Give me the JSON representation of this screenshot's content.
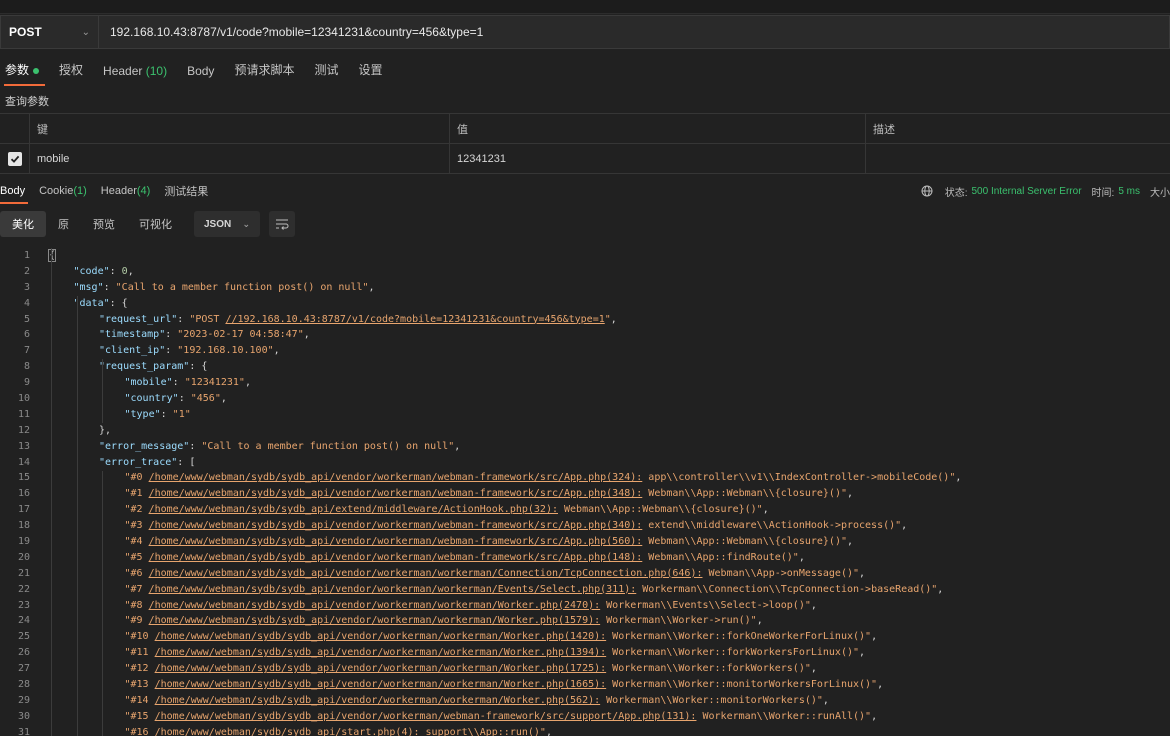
{
  "request": {
    "method": "POST",
    "url": "192.168.10.43:8787/v1/code?mobile=12341231&country=456&type=1"
  },
  "req_tabs": [
    {
      "label": "参数",
      "dot": true,
      "active": true
    },
    {
      "label": "授权"
    },
    {
      "label": "Header",
      "count": "(10)"
    },
    {
      "label": "Body"
    },
    {
      "label": "预请求脚本"
    },
    {
      "label": "测试"
    },
    {
      "label": "设置"
    }
  ],
  "params": {
    "section_title": "查询参数",
    "headers": {
      "key": "键",
      "value": "值",
      "desc": "描述"
    },
    "rows": [
      {
        "key": "mobile",
        "value": "12341231",
        "desc": ""
      }
    ]
  },
  "res_tabs": [
    {
      "label": "Body",
      "active": true
    },
    {
      "label": "Cookie",
      "count": "(1)"
    },
    {
      "label": "Header",
      "count": "(4)"
    },
    {
      "label": "测试结果"
    }
  ],
  "status": {
    "status_label": "状态:",
    "status_value": "500 Internal Server Error",
    "time_label": "时间:",
    "time_value": "5 ms",
    "size_label": "大小"
  },
  "view_tabs": [
    "美化",
    "原",
    "预览",
    "可视化"
  ],
  "format": "JSON",
  "icons": {
    "method_chevron": "chevron-down-icon",
    "checkbox": "check-icon",
    "network": "globe-icon",
    "wrap": "wrap-lines-icon"
  },
  "colors": {
    "accent": "#f26b3a",
    "success": "#3bc16e",
    "key": "#9cdcfe",
    "string": "#e8a56e"
  },
  "code_lines": [
    {
      "n": "1",
      "i": 0,
      "t": [
        [
          "p",
          "{"
        ]
      ]
    },
    {
      "n": "2",
      "i": 1,
      "t": [
        [
          "k",
          "\"code\""
        ],
        [
          "p",
          ": "
        ],
        [
          "n",
          "0"
        ],
        [
          "p",
          ","
        ]
      ]
    },
    {
      "n": "3",
      "i": 1,
      "t": [
        [
          "k",
          "\"msg\""
        ],
        [
          "p",
          ": "
        ],
        [
          "s",
          "\"Call to a member function post() on null\""
        ],
        [
          "p",
          ","
        ]
      ]
    },
    {
      "n": "4",
      "i": 1,
      "t": [
        [
          "k",
          "\"data\""
        ],
        [
          "p",
          ": {"
        ]
      ]
    },
    {
      "n": "5",
      "i": 2,
      "t": [
        [
          "k",
          "\"request_url\""
        ],
        [
          "p",
          ": "
        ],
        [
          "s",
          "\"POST "
        ],
        [
          "su",
          "//192.168.10.43:8787/v1/code?mobile=12341231&country=456&type=1"
        ],
        [
          "s",
          "\""
        ],
        [
          "p",
          ","
        ]
      ]
    },
    {
      "n": "6",
      "i": 2,
      "t": [
        [
          "k",
          "\"timestamp\""
        ],
        [
          "p",
          ": "
        ],
        [
          "s",
          "\"2023-02-17 04:58:47\""
        ],
        [
          "p",
          ","
        ]
      ]
    },
    {
      "n": "7",
      "i": 2,
      "t": [
        [
          "k",
          "\"client_ip\""
        ],
        [
          "p",
          ": "
        ],
        [
          "s",
          "\"192.168.10.100\""
        ],
        [
          "p",
          ","
        ]
      ]
    },
    {
      "n": "8",
      "i": 2,
      "t": [
        [
          "k",
          "\"request_param\""
        ],
        [
          "p",
          ": {"
        ]
      ]
    },
    {
      "n": "9",
      "i": 3,
      "t": [
        [
          "k",
          "\"mobile\""
        ],
        [
          "p",
          ": "
        ],
        [
          "s",
          "\"12341231\""
        ],
        [
          "p",
          ","
        ]
      ]
    },
    {
      "n": "10",
      "i": 3,
      "t": [
        [
          "k",
          "\"country\""
        ],
        [
          "p",
          ": "
        ],
        [
          "s",
          "\"456\""
        ],
        [
          "p",
          ","
        ]
      ]
    },
    {
      "n": "11",
      "i": 3,
      "t": [
        [
          "k",
          "\"type\""
        ],
        [
          "p",
          ": "
        ],
        [
          "s",
          "\"1\""
        ]
      ]
    },
    {
      "n": "12",
      "i": 2,
      "t": [
        [
          "p",
          "},"
        ]
      ]
    },
    {
      "n": "13",
      "i": 2,
      "t": [
        [
          "k",
          "\"error_message\""
        ],
        [
          "p",
          ": "
        ],
        [
          "s",
          "\"Call to a member function post() on null\""
        ],
        [
          "p",
          ","
        ]
      ]
    },
    {
      "n": "14",
      "i": 2,
      "t": [
        [
          "k",
          "\"error_trace\""
        ],
        [
          "p",
          ": ["
        ]
      ]
    },
    {
      "n": "15",
      "i": 3,
      "t": [
        [
          "s",
          "\"#0 "
        ],
        [
          "su",
          "/home/www/webman/sydb/sydb_api/vendor/workerman/webman-framework/src/App.php(324):"
        ],
        [
          "s",
          " app\\\\controller\\\\v1\\\\IndexController->mobileCode()\""
        ],
        [
          "p",
          ","
        ]
      ]
    },
    {
      "n": "16",
      "i": 3,
      "t": [
        [
          "s",
          "\"#1 "
        ],
        [
          "su",
          "/home/www/webman/sydb/sydb_api/vendor/workerman/webman-framework/src/App.php(348):"
        ],
        [
          "s",
          " Webman\\\\App::Webman\\\\{closure}()\""
        ],
        [
          "p",
          ","
        ]
      ]
    },
    {
      "n": "17",
      "i": 3,
      "t": [
        [
          "s",
          "\"#2 "
        ],
        [
          "su",
          "/home/www/webman/sydb/sydb_api/extend/middleware/ActionHook.php(32):"
        ],
        [
          "s",
          " Webman\\\\App::Webman\\\\{closure}()\""
        ],
        [
          "p",
          ","
        ]
      ]
    },
    {
      "n": "18",
      "i": 3,
      "t": [
        [
          "s",
          "\"#3 "
        ],
        [
          "su",
          "/home/www/webman/sydb/sydb_api/vendor/workerman/webman-framework/src/App.php(340):"
        ],
        [
          "s",
          " extend\\\\middleware\\\\ActionHook->process()\""
        ],
        [
          "p",
          ","
        ]
      ]
    },
    {
      "n": "19",
      "i": 3,
      "t": [
        [
          "s",
          "\"#4 "
        ],
        [
          "su",
          "/home/www/webman/sydb/sydb_api/vendor/workerman/webman-framework/src/App.php(560):"
        ],
        [
          "s",
          " Webman\\\\App::Webman\\\\{closure}()\""
        ],
        [
          "p",
          ","
        ]
      ]
    },
    {
      "n": "20",
      "i": 3,
      "t": [
        [
          "s",
          "\"#5 "
        ],
        [
          "su",
          "/home/www/webman/sydb/sydb_api/vendor/workerman/webman-framework/src/App.php(148):"
        ],
        [
          "s",
          " Webman\\\\App::findRoute()\""
        ],
        [
          "p",
          ","
        ]
      ]
    },
    {
      "n": "21",
      "i": 3,
      "t": [
        [
          "s",
          "\"#6 "
        ],
        [
          "su",
          "/home/www/webman/sydb/sydb_api/vendor/workerman/workerman/Connection/TcpConnection.php(646):"
        ],
        [
          "s",
          " Webman\\\\App->onMessage()\""
        ],
        [
          "p",
          ","
        ]
      ]
    },
    {
      "n": "22",
      "i": 3,
      "t": [
        [
          "s",
          "\"#7 "
        ],
        [
          "su",
          "/home/www/webman/sydb/sydb_api/vendor/workerman/workerman/Events/Select.php(311):"
        ],
        [
          "s",
          " Workerman\\\\Connection\\\\TcpConnection->baseRead()\""
        ],
        [
          "p",
          ","
        ]
      ]
    },
    {
      "n": "23",
      "i": 3,
      "t": [
        [
          "s",
          "\"#8 "
        ],
        [
          "su",
          "/home/www/webman/sydb/sydb_api/vendor/workerman/workerman/Worker.php(2470):"
        ],
        [
          "s",
          " Workerman\\\\Events\\\\Select->loop()\""
        ],
        [
          "p",
          ","
        ]
      ]
    },
    {
      "n": "24",
      "i": 3,
      "t": [
        [
          "s",
          "\"#9 "
        ],
        [
          "su",
          "/home/www/webman/sydb/sydb_api/vendor/workerman/workerman/Worker.php(1579):"
        ],
        [
          "s",
          " Workerman\\\\Worker->run()\""
        ],
        [
          "p",
          ","
        ]
      ]
    },
    {
      "n": "25",
      "i": 3,
      "t": [
        [
          "s",
          "\"#10 "
        ],
        [
          "su",
          "/home/www/webman/sydb/sydb_api/vendor/workerman/workerman/Worker.php(1420):"
        ],
        [
          "s",
          " Workerman\\\\Worker::forkOneWorkerForLinux()\""
        ],
        [
          "p",
          ","
        ]
      ]
    },
    {
      "n": "26",
      "i": 3,
      "t": [
        [
          "s",
          "\"#11 "
        ],
        [
          "su",
          "/home/www/webman/sydb/sydb_api/vendor/workerman/workerman/Worker.php(1394):"
        ],
        [
          "s",
          " Workerman\\\\Worker::forkWorkersForLinux()\""
        ],
        [
          "p",
          ","
        ]
      ]
    },
    {
      "n": "27",
      "i": 3,
      "t": [
        [
          "s",
          "\"#12 "
        ],
        [
          "su",
          "/home/www/webman/sydb/sydb_api/vendor/workerman/workerman/Worker.php(1725):"
        ],
        [
          "s",
          " Workerman\\\\Worker::forkWorkers()\""
        ],
        [
          "p",
          ","
        ]
      ]
    },
    {
      "n": "28",
      "i": 3,
      "t": [
        [
          "s",
          "\"#13 "
        ],
        [
          "su",
          "/home/www/webman/sydb/sydb_api/vendor/workerman/workerman/Worker.php(1665):"
        ],
        [
          "s",
          " Workerman\\\\Worker::monitorWorkersForLinux()\""
        ],
        [
          "p",
          ","
        ]
      ]
    },
    {
      "n": "29",
      "i": 3,
      "t": [
        [
          "s",
          "\"#14 "
        ],
        [
          "su",
          "/home/www/webman/sydb/sydb_api/vendor/workerman/workerman/Worker.php(562):"
        ],
        [
          "s",
          " Workerman\\\\Worker::monitorWorkers()\""
        ],
        [
          "p",
          ","
        ]
      ]
    },
    {
      "n": "30",
      "i": 3,
      "t": [
        [
          "s",
          "\"#15 "
        ],
        [
          "su",
          "/home/www/webman/sydb/sydb_api/vendor/workerman/webman-framework/src/support/App.php(131):"
        ],
        [
          "s",
          " Workerman\\\\Worker::runAll()\""
        ],
        [
          "p",
          ","
        ]
      ]
    },
    {
      "n": "31",
      "i": 3,
      "t": [
        [
          "s",
          "\"#16 "
        ],
        [
          "su",
          "/home/www/webman/sydb/sydb_api/start.php(4):"
        ],
        [
          "s",
          " support\\\\App::run()\""
        ],
        [
          "p",
          ","
        ]
      ]
    }
  ]
}
